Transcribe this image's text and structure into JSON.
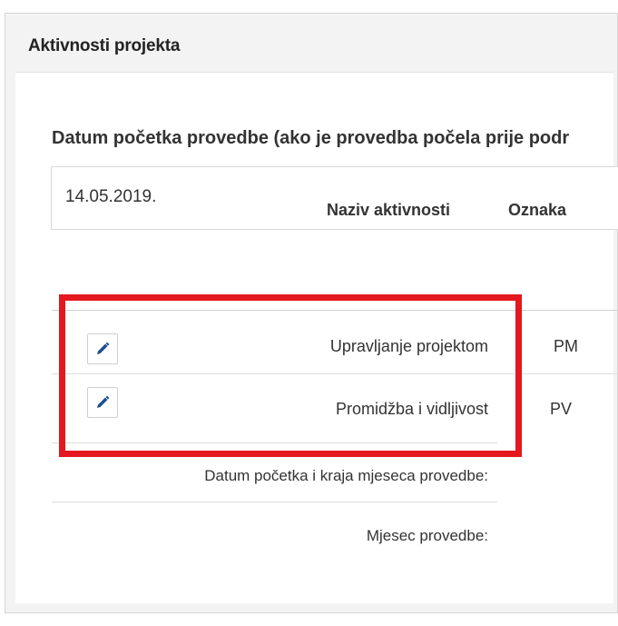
{
  "top_text": "",
  "panel": {
    "title": "Aktivnosti projekta"
  },
  "start_date": {
    "label": "Datum početka provedbe (ako je provedba počela prije podr",
    "value": "14.05.2019."
  },
  "table": {
    "headers": {
      "name": "Naziv aktivnosti",
      "code": "Oznaka"
    },
    "rows": [
      {
        "name": "Upravljanje projektom",
        "code": "PM",
        "edit_icon": "pencil-icon"
      },
      {
        "name": "Promidžba i vidljivost",
        "code": "PV",
        "edit_icon": "pencil-icon"
      }
    ]
  },
  "fields": {
    "start_end_month_label": "Datum početka i kraja mjeseca provedbe:",
    "month_label": "Mjesec provedbe:"
  },
  "colors": {
    "highlight": "#e4181f",
    "pencil": "#1d4f91",
    "header_bg": "#f3f3f3"
  }
}
